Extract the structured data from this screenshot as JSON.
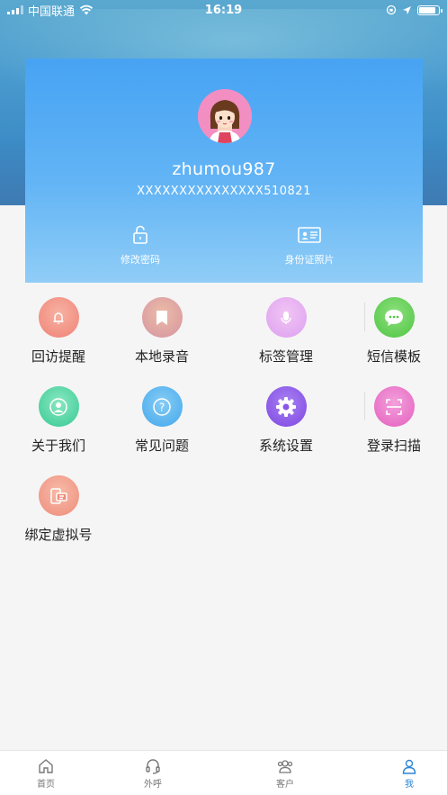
{
  "status_bar": {
    "carrier": "中国联通",
    "time": "16:19",
    "battery_level": 0.85
  },
  "profile": {
    "username": "zhumou987",
    "id_number": "XXXXXXXXXXXXXXX510821",
    "actions": [
      {
        "label": "修改密码",
        "icon": "unlock-icon"
      },
      {
        "label": "身份证照片",
        "icon": "id-card-icon"
      }
    ]
  },
  "menu": [
    {
      "label": "回访提醒",
      "icon": "bell-icon",
      "color": "#f0887c"
    },
    {
      "label": "本地录音",
      "icon": "bookmark-icon",
      "color": "#d59a8c"
    },
    {
      "label": "标签管理",
      "icon": "microphone-icon",
      "color": "#e7a8f0"
    },
    {
      "label": "短信模板",
      "icon": "chat-bubble-icon",
      "color": "#5ccc4f"
    },
    {
      "label": "关于我们",
      "icon": "user-icon",
      "color": "#3fcf9a"
    },
    {
      "label": "常见问题",
      "icon": "question-icon",
      "color": "#4ab0ef"
    },
    {
      "label": "系统设置",
      "icon": "gear-icon",
      "color": "#8b56e8"
    },
    {
      "label": "登录扫描",
      "icon": "scan-icon",
      "color": "#ea68c6"
    },
    {
      "label": "绑定虚拟号",
      "icon": "virtual-number-icon",
      "color": "#f0907c"
    }
  ],
  "tabs": [
    {
      "label": "首页",
      "icon": "home-icon"
    },
    {
      "label": "外呼",
      "icon": "headset-icon"
    },
    {
      "label": "客户",
      "icon": "customers-icon"
    },
    {
      "label": "我",
      "icon": "person-icon"
    }
  ],
  "colors": {
    "accent": "#2c86d8",
    "card_top": "#47a3f3",
    "card_bottom": "#90cdf7"
  }
}
